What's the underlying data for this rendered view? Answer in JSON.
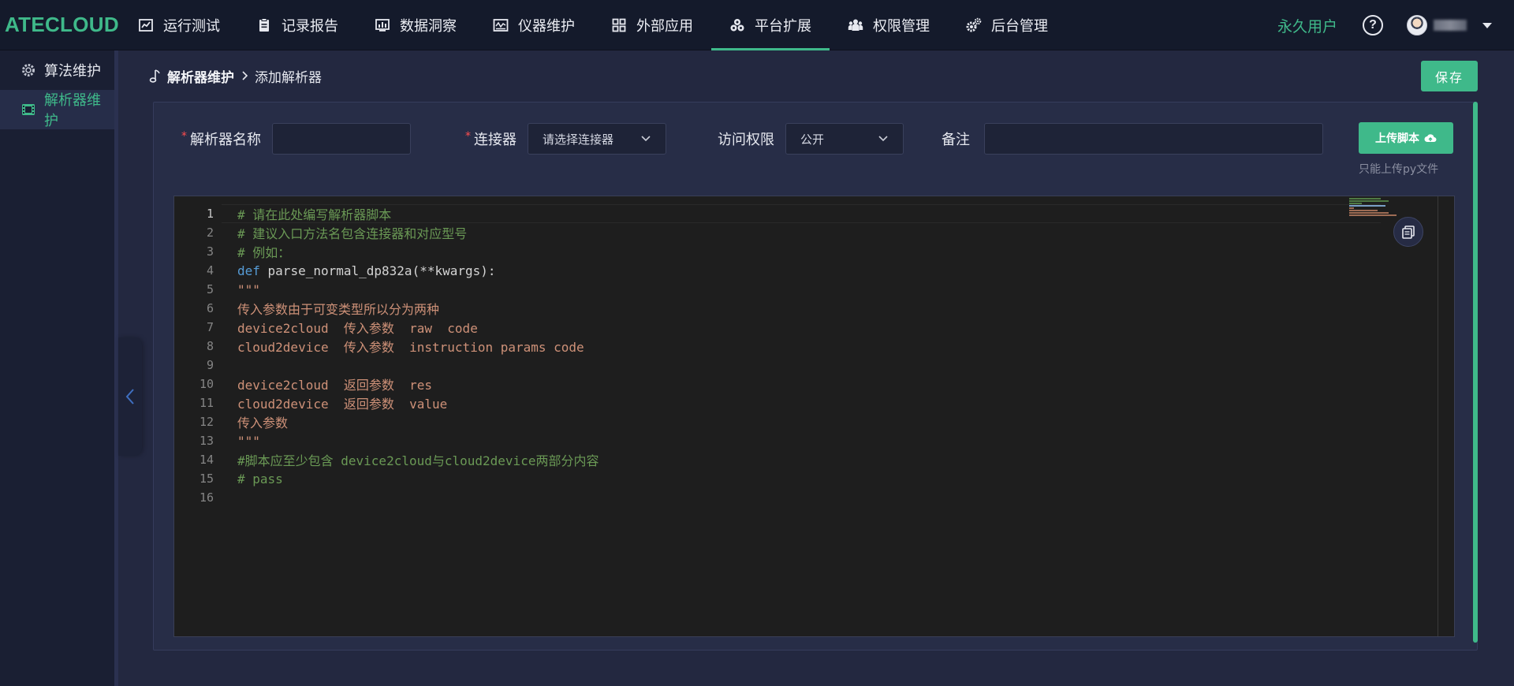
{
  "app": {
    "logo": "ATECLOUD"
  },
  "nav": [
    {
      "label": "运行测试",
      "icon": "chart-line-icon",
      "active": false
    },
    {
      "label": "记录报告",
      "icon": "clipboard-icon",
      "active": false
    },
    {
      "label": "数据洞察",
      "icon": "bar-chart-icon",
      "active": false
    },
    {
      "label": "仪器维护",
      "icon": "instrument-icon",
      "active": false
    },
    {
      "label": "外部应用",
      "icon": "grid-icon",
      "active": false
    },
    {
      "label": "平台扩展",
      "icon": "cubes-icon",
      "active": true
    },
    {
      "label": "权限管理",
      "icon": "users-icon",
      "active": false
    },
    {
      "label": "后台管理",
      "icon": "cogs-icon",
      "active": false
    }
  ],
  "header": {
    "user_type": "永久用户",
    "help_glyph": "?"
  },
  "sidebar": {
    "items": [
      {
        "label": "算法维护",
        "icon": "gear-icon",
        "active": false
      },
      {
        "label": "解析器维护",
        "icon": "film-icon",
        "active": true
      }
    ]
  },
  "breadcrumb": {
    "root": "解析器维护",
    "current": "添加解析器"
  },
  "toolbar": {
    "save_label": "保存"
  },
  "form": {
    "name_label": "解析器名称",
    "name_value": "",
    "connector_label": "连接器",
    "connector_placeholder": "请选择连接器",
    "access_label": "访问权限",
    "access_value": "公开",
    "note_label": "备注",
    "note_value": "",
    "required_mark": "*",
    "upload_label": "上传脚本",
    "upload_hint": "只能上传py文件"
  },
  "editor": {
    "current_line": 1,
    "lines": [
      {
        "n": "1",
        "tokens": [
          {
            "t": "# 请在此处编写解析器脚本",
            "c": "comment"
          }
        ]
      },
      {
        "n": "2",
        "tokens": [
          {
            "t": "# 建议入口方法名包含连接器和对应型号",
            "c": "comment"
          }
        ]
      },
      {
        "n": "3",
        "tokens": [
          {
            "t": "# 例如：",
            "c": "comment"
          }
        ]
      },
      {
        "n": "4",
        "tokens": [
          {
            "t": "def",
            "c": "keyword"
          },
          {
            "t": " parse_normal_dp832a(**kwargs):",
            "c": "plain"
          }
        ]
      },
      {
        "n": "5",
        "tokens": [
          {
            "t": "\"\"\"",
            "c": "string"
          }
        ]
      },
      {
        "n": "6",
        "tokens": [
          {
            "t": "传入参数由于可变类型所以分为两种",
            "c": "string"
          }
        ]
      },
      {
        "n": "7",
        "tokens": [
          {
            "t": "device2cloud  传入参数  raw  code",
            "c": "string"
          }
        ]
      },
      {
        "n": "8",
        "tokens": [
          {
            "t": "cloud2device  传入参数  instruction params code",
            "c": "string"
          }
        ]
      },
      {
        "n": "9",
        "tokens": [
          {
            "t": "",
            "c": "string"
          }
        ]
      },
      {
        "n": "10",
        "tokens": [
          {
            "t": "device2cloud  返回参数  res",
            "c": "string"
          }
        ]
      },
      {
        "n": "11",
        "tokens": [
          {
            "t": "cloud2device  返回参数  value",
            "c": "string"
          }
        ]
      },
      {
        "n": "12",
        "tokens": [
          {
            "t": "传入参数",
            "c": "string"
          }
        ]
      },
      {
        "n": "13",
        "tokens": [
          {
            "t": "\"\"\"",
            "c": "string"
          }
        ]
      },
      {
        "n": "14",
        "tokens": [
          {
            "t": "#脚本应至少包含 device2cloud与cloud2device两部分内容",
            "c": "comment"
          }
        ]
      },
      {
        "n": "15",
        "tokens": [
          {
            "t": "# pass",
            "c": "comment"
          }
        ]
      },
      {
        "n": "16",
        "tokens": []
      }
    ]
  },
  "colors": {
    "accent": "#3fb98a",
    "topbar_bg": "#141a2b",
    "page_bg": "#232840",
    "panel_bg": "#272d47",
    "editor_bg": "#1e1e1e",
    "required": "#ff4d4f"
  }
}
